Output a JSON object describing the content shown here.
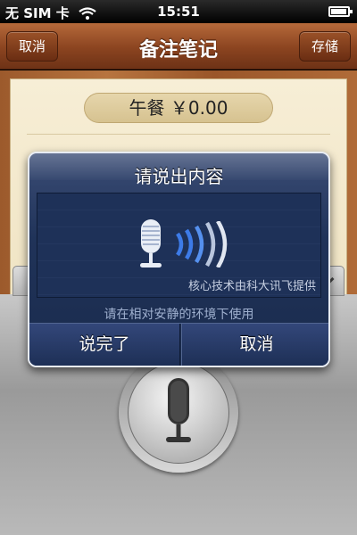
{
  "status_bar": {
    "carrier": "无 SIM 卡",
    "time": "15:51"
  },
  "nav": {
    "title": "备注笔记",
    "left_button": "取消",
    "right_button": "存储"
  },
  "note": {
    "amount": "午餐 ￥0.00"
  },
  "dialog": {
    "title": "请说出内容",
    "credit": "核心技术由科大讯飞提供",
    "hint": "请在相对安静的环境下使用",
    "done_button": "说完了",
    "cancel_button": "取消"
  },
  "icons": [
    "wifi-icon",
    "battery-icon",
    "keyboard-icon",
    "microphone-icon",
    "chevron-down-icon",
    "sound-wave-icon"
  ]
}
